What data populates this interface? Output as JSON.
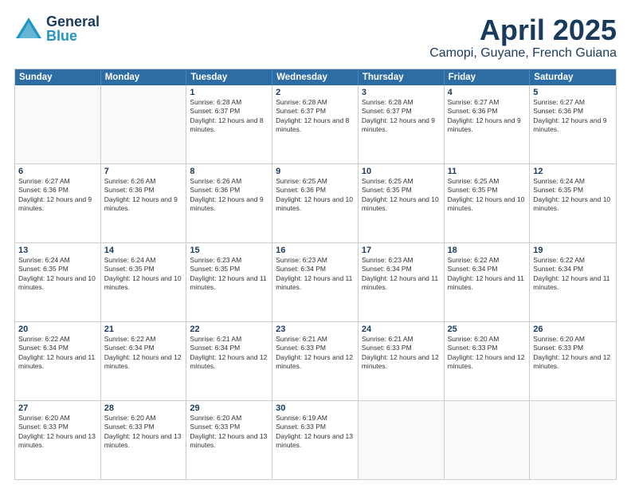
{
  "header": {
    "logo_general": "General",
    "logo_blue": "Blue",
    "month": "April 2025",
    "location": "Camopi, Guyane, French Guiana"
  },
  "weekdays": [
    "Sunday",
    "Monday",
    "Tuesday",
    "Wednesday",
    "Thursday",
    "Friday",
    "Saturday"
  ],
  "rows": [
    [
      {
        "day": "",
        "info": ""
      },
      {
        "day": "",
        "info": ""
      },
      {
        "day": "1",
        "info": "Sunrise: 6:28 AM\nSunset: 6:37 PM\nDaylight: 12 hours and 8 minutes."
      },
      {
        "day": "2",
        "info": "Sunrise: 6:28 AM\nSunset: 6:37 PM\nDaylight: 12 hours and 8 minutes."
      },
      {
        "day": "3",
        "info": "Sunrise: 6:28 AM\nSunset: 6:37 PM\nDaylight: 12 hours and 9 minutes."
      },
      {
        "day": "4",
        "info": "Sunrise: 6:27 AM\nSunset: 6:36 PM\nDaylight: 12 hours and 9 minutes."
      },
      {
        "day": "5",
        "info": "Sunrise: 6:27 AM\nSunset: 6:36 PM\nDaylight: 12 hours and 9 minutes."
      }
    ],
    [
      {
        "day": "6",
        "info": "Sunrise: 6:27 AM\nSunset: 6:36 PM\nDaylight: 12 hours and 9 minutes."
      },
      {
        "day": "7",
        "info": "Sunrise: 6:26 AM\nSunset: 6:36 PM\nDaylight: 12 hours and 9 minutes."
      },
      {
        "day": "8",
        "info": "Sunrise: 6:26 AM\nSunset: 6:36 PM\nDaylight: 12 hours and 9 minutes."
      },
      {
        "day": "9",
        "info": "Sunrise: 6:25 AM\nSunset: 6:36 PM\nDaylight: 12 hours and 10 minutes."
      },
      {
        "day": "10",
        "info": "Sunrise: 6:25 AM\nSunset: 6:35 PM\nDaylight: 12 hours and 10 minutes."
      },
      {
        "day": "11",
        "info": "Sunrise: 6:25 AM\nSunset: 6:35 PM\nDaylight: 12 hours and 10 minutes."
      },
      {
        "day": "12",
        "info": "Sunrise: 6:24 AM\nSunset: 6:35 PM\nDaylight: 12 hours and 10 minutes."
      }
    ],
    [
      {
        "day": "13",
        "info": "Sunrise: 6:24 AM\nSunset: 6:35 PM\nDaylight: 12 hours and 10 minutes."
      },
      {
        "day": "14",
        "info": "Sunrise: 6:24 AM\nSunset: 6:35 PM\nDaylight: 12 hours and 10 minutes."
      },
      {
        "day": "15",
        "info": "Sunrise: 6:23 AM\nSunset: 6:35 PM\nDaylight: 12 hours and 11 minutes."
      },
      {
        "day": "16",
        "info": "Sunrise: 6:23 AM\nSunset: 6:34 PM\nDaylight: 12 hours and 11 minutes."
      },
      {
        "day": "17",
        "info": "Sunrise: 6:23 AM\nSunset: 6:34 PM\nDaylight: 12 hours and 11 minutes."
      },
      {
        "day": "18",
        "info": "Sunrise: 6:22 AM\nSunset: 6:34 PM\nDaylight: 12 hours and 11 minutes."
      },
      {
        "day": "19",
        "info": "Sunrise: 6:22 AM\nSunset: 6:34 PM\nDaylight: 12 hours and 11 minutes."
      }
    ],
    [
      {
        "day": "20",
        "info": "Sunrise: 6:22 AM\nSunset: 6:34 PM\nDaylight: 12 hours and 11 minutes."
      },
      {
        "day": "21",
        "info": "Sunrise: 6:22 AM\nSunset: 6:34 PM\nDaylight: 12 hours and 12 minutes."
      },
      {
        "day": "22",
        "info": "Sunrise: 6:21 AM\nSunset: 6:34 PM\nDaylight: 12 hours and 12 minutes."
      },
      {
        "day": "23",
        "info": "Sunrise: 6:21 AM\nSunset: 6:33 PM\nDaylight: 12 hours and 12 minutes."
      },
      {
        "day": "24",
        "info": "Sunrise: 6:21 AM\nSunset: 6:33 PM\nDaylight: 12 hours and 12 minutes."
      },
      {
        "day": "25",
        "info": "Sunrise: 6:20 AM\nSunset: 6:33 PM\nDaylight: 12 hours and 12 minutes."
      },
      {
        "day": "26",
        "info": "Sunrise: 6:20 AM\nSunset: 6:33 PM\nDaylight: 12 hours and 12 minutes."
      }
    ],
    [
      {
        "day": "27",
        "info": "Sunrise: 6:20 AM\nSunset: 6:33 PM\nDaylight: 12 hours and 13 minutes."
      },
      {
        "day": "28",
        "info": "Sunrise: 6:20 AM\nSunset: 6:33 PM\nDaylight: 12 hours and 13 minutes."
      },
      {
        "day": "29",
        "info": "Sunrise: 6:20 AM\nSunset: 6:33 PM\nDaylight: 12 hours and 13 minutes."
      },
      {
        "day": "30",
        "info": "Sunrise: 6:19 AM\nSunset: 6:33 PM\nDaylight: 12 hours and 13 minutes."
      },
      {
        "day": "",
        "info": ""
      },
      {
        "day": "",
        "info": ""
      },
      {
        "day": "",
        "info": ""
      }
    ]
  ]
}
